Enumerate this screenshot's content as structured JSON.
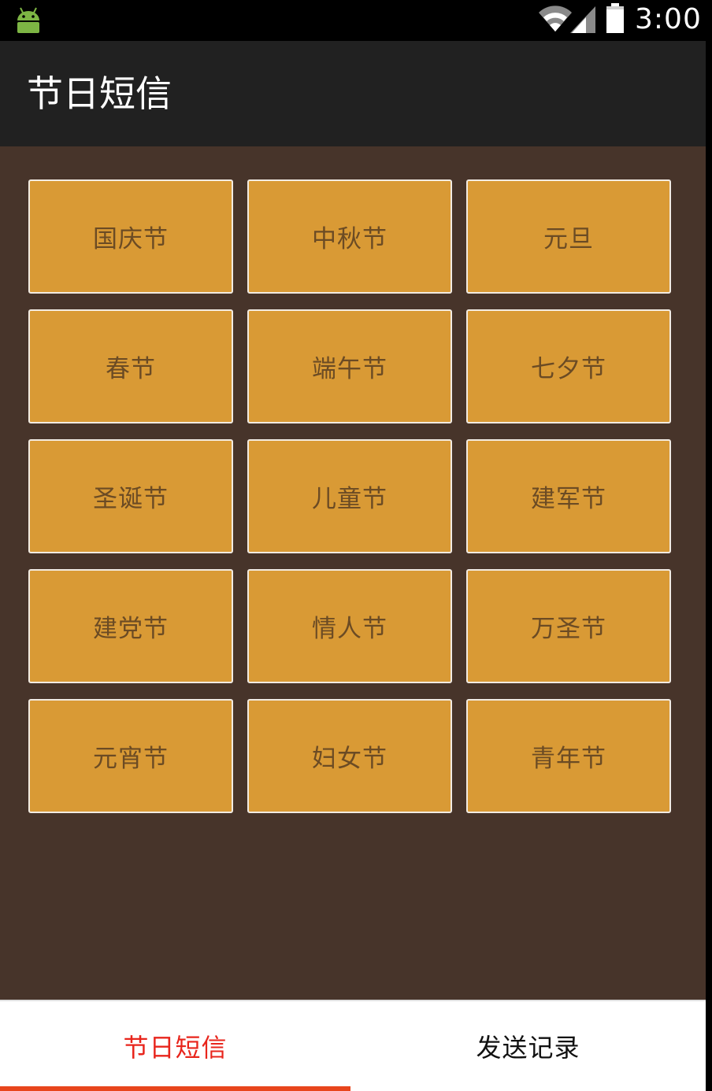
{
  "status_bar": {
    "time": "3:00",
    "icons": [
      "android-icon",
      "wifi-icon",
      "signal-icon",
      "battery-icon"
    ]
  },
  "app": {
    "title": "节日短信"
  },
  "festivals": [
    "国庆节",
    "中秋节",
    "元旦",
    "春节",
    "端午节",
    "七夕节",
    "圣诞节",
    "儿童节",
    "建军节",
    "建党节",
    "情人节",
    "万圣节",
    "元宵节",
    "妇女节",
    "青年节"
  ],
  "tabs": [
    {
      "label": "节日短信",
      "selected": true
    },
    {
      "label": "发送记录",
      "selected": false
    }
  ],
  "colors": {
    "content_background": "#47342a",
    "tile_background": "#d99a35",
    "tile_text": "#6b4b24",
    "active_tab": "#e8251c"
  }
}
